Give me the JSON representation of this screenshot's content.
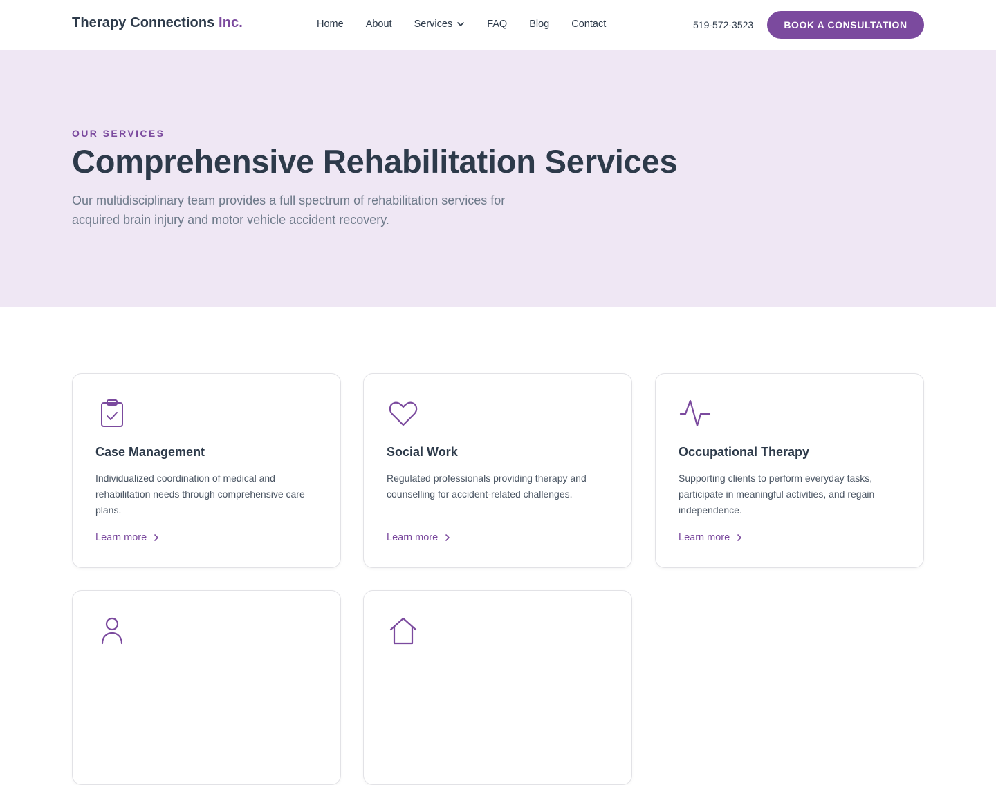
{
  "header": {
    "logo_main": "Therapy Connections",
    "logo_accent": "Inc.",
    "nav": [
      {
        "label": "Home"
      },
      {
        "label": "About"
      },
      {
        "label": "Services",
        "icon": "chevron-down-icon"
      },
      {
        "label": "FAQ"
      },
      {
        "label": "Blog"
      },
      {
        "label": "Contact"
      }
    ],
    "phone": "519-572-3523",
    "cta_label": "BOOK A CONSULTATION"
  },
  "hero": {
    "eyebrow": "OUR SERVICES",
    "title": "Comprehensive Rehabilitation Services",
    "subtitle": "Our multidisciplinary team provides a full spectrum of rehabilitation services for acquired brain injury and motor vehicle accident recovery."
  },
  "services": [
    {
      "icon": "clipboard-check-icon",
      "title": "Case Management",
      "description": "Individualized coordination of medical and rehabilitation needs through comprehensive care plans.",
      "link_label": "Learn more"
    },
    {
      "icon": "heart-icon",
      "title": "Social Work",
      "description": "Regulated professionals providing therapy and counselling for accident-related challenges.",
      "link_label": "Learn more"
    },
    {
      "icon": "activity-icon",
      "title": "Occupational Therapy",
      "description": "Supporting clients to perform everyday tasks, participate in meaningful activities, and regain independence.",
      "link_label": "Learn more"
    }
  ],
  "colors": {
    "accent": "#7b4a9e",
    "hero_bg": "#efe7f4",
    "heading": "#2d3a4a",
    "muted": "#6e7a8a"
  }
}
